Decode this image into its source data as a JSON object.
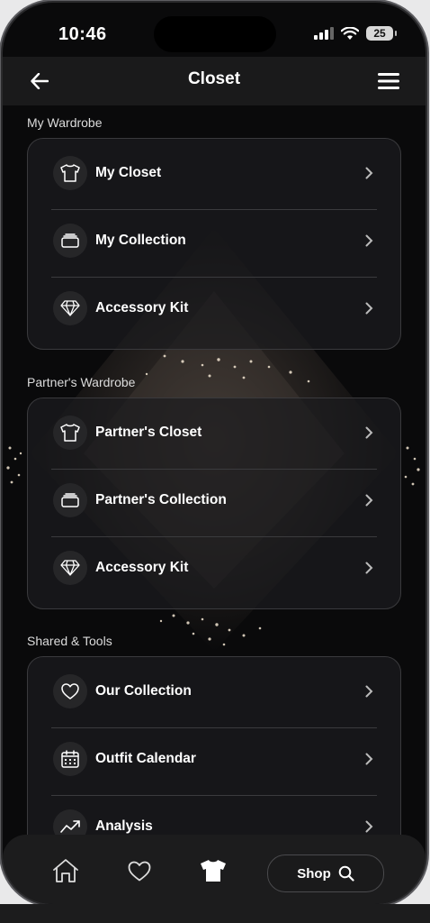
{
  "status_bar": {
    "time": "10:46",
    "battery": "25"
  },
  "header": {
    "title": "Closet"
  },
  "sections": [
    {
      "label": "My Wardrobe",
      "items": [
        {
          "label": "My Closet",
          "icon": "tshirt-icon"
        },
        {
          "label": "My Collection",
          "icon": "stack-icon"
        },
        {
          "label": "Accessory Kit",
          "icon": "diamond-icon"
        }
      ]
    },
    {
      "label": "Partner's Wardrobe",
      "items": [
        {
          "label": "Partner's Closet",
          "icon": "tshirt-icon"
        },
        {
          "label": "Partner's Collection",
          "icon": "stack-icon"
        },
        {
          "label": "Accessory Kit",
          "icon": "diamond-icon"
        }
      ]
    },
    {
      "label": "Shared & Tools",
      "items": [
        {
          "label": "Our Collection",
          "icon": "heart-icon"
        },
        {
          "label": "Outfit Calendar",
          "icon": "calendar-icon"
        },
        {
          "label": "Analysis",
          "icon": "trend-icon"
        }
      ]
    }
  ],
  "tab_bar": {
    "shop_label": "Shop",
    "active_tab": "closet"
  },
  "colors": {
    "background": "#0a0a0b",
    "card": "#1c1c1e",
    "text": "#ffffff"
  }
}
